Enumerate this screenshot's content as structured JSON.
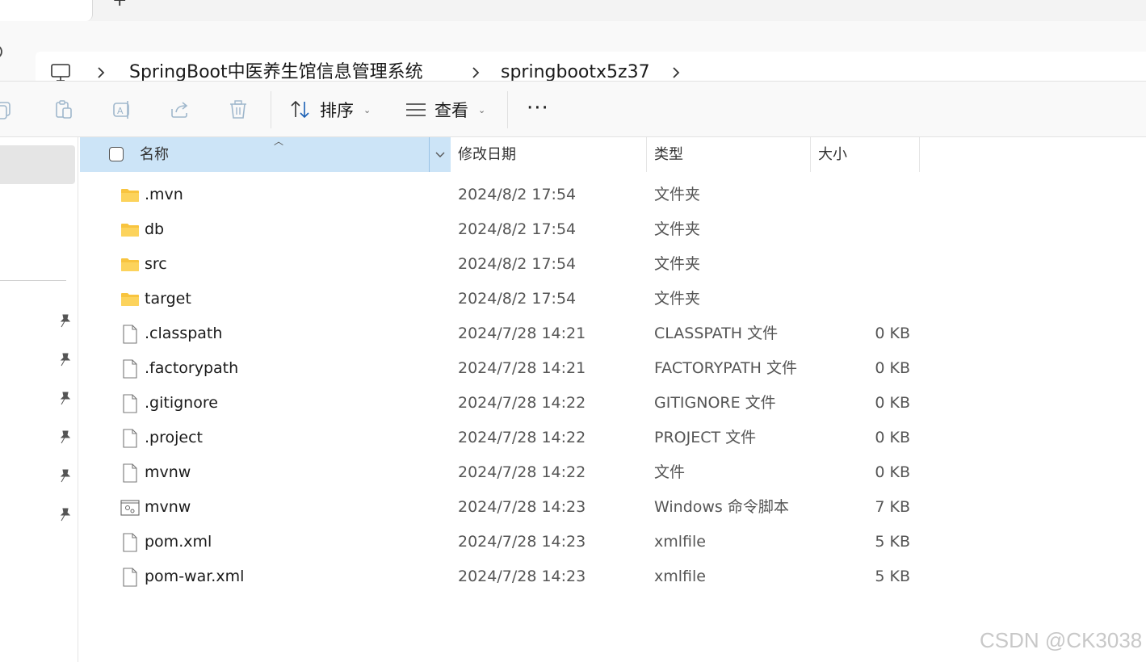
{
  "tabs": {
    "close_glyph": "×",
    "new_glyph": "+"
  },
  "breadcrumb": {
    "items": [
      {
        "label": "SpringBoot中医养生馆信息管理系统"
      },
      {
        "label": "springbootx5z37"
      }
    ]
  },
  "toolbar": {
    "sort_label": "排序",
    "view_label": "查看",
    "more_label": "···",
    "icons": [
      "copy-icon",
      "paste-icon",
      "rename-icon",
      "share-icon",
      "delete-icon"
    ]
  },
  "columns": {
    "name": "名称",
    "date": "修改日期",
    "type": "类型",
    "size": "大小"
  },
  "files": [
    {
      "name": ".mvn",
      "date": "2024/8/2 17:54",
      "type": "文件夹",
      "size": "",
      "icon": "folder-icon"
    },
    {
      "name": "db",
      "date": "2024/8/2 17:54",
      "type": "文件夹",
      "size": "",
      "icon": "folder-icon"
    },
    {
      "name": "src",
      "date": "2024/8/2 17:54",
      "type": "文件夹",
      "size": "",
      "icon": "folder-icon"
    },
    {
      "name": "target",
      "date": "2024/8/2 17:54",
      "type": "文件夹",
      "size": "",
      "icon": "folder-icon"
    },
    {
      "name": ".classpath",
      "date": "2024/7/28 14:21",
      "type": "CLASSPATH 文件",
      "size": "0 KB",
      "icon": "file-icon"
    },
    {
      "name": ".factorypath",
      "date": "2024/7/28 14:21",
      "type": "FACTORYPATH 文件",
      "size": "0 KB",
      "icon": "file-icon"
    },
    {
      "name": ".gitignore",
      "date": "2024/7/28 14:22",
      "type": "GITIGNORE 文件",
      "size": "0 KB",
      "icon": "file-icon"
    },
    {
      "name": ".project",
      "date": "2024/7/28 14:22",
      "type": "PROJECT 文件",
      "size": "0 KB",
      "icon": "file-icon"
    },
    {
      "name": "mvnw",
      "date": "2024/7/28 14:22",
      "type": "文件",
      "size": "0 KB",
      "icon": "file-icon"
    },
    {
      "name": "mvnw",
      "date": "2024/7/28 14:23",
      "type": "Windows 命令脚本",
      "size": "7 KB",
      "icon": "script-icon"
    },
    {
      "name": "pom.xml",
      "date": "2024/7/28 14:23",
      "type": "xmlfile",
      "size": "5 KB",
      "icon": "file-icon"
    },
    {
      "name": "pom-war.xml",
      "date": "2024/7/28 14:23",
      "type": "xmlfile",
      "size": "5 KB",
      "icon": "file-icon"
    }
  ],
  "watermark": "CSDN @CK3038",
  "colors": {
    "selection": "#cce4f7",
    "folder": "#f8c43f",
    "toolbar_bg": "#f9f9f9"
  }
}
